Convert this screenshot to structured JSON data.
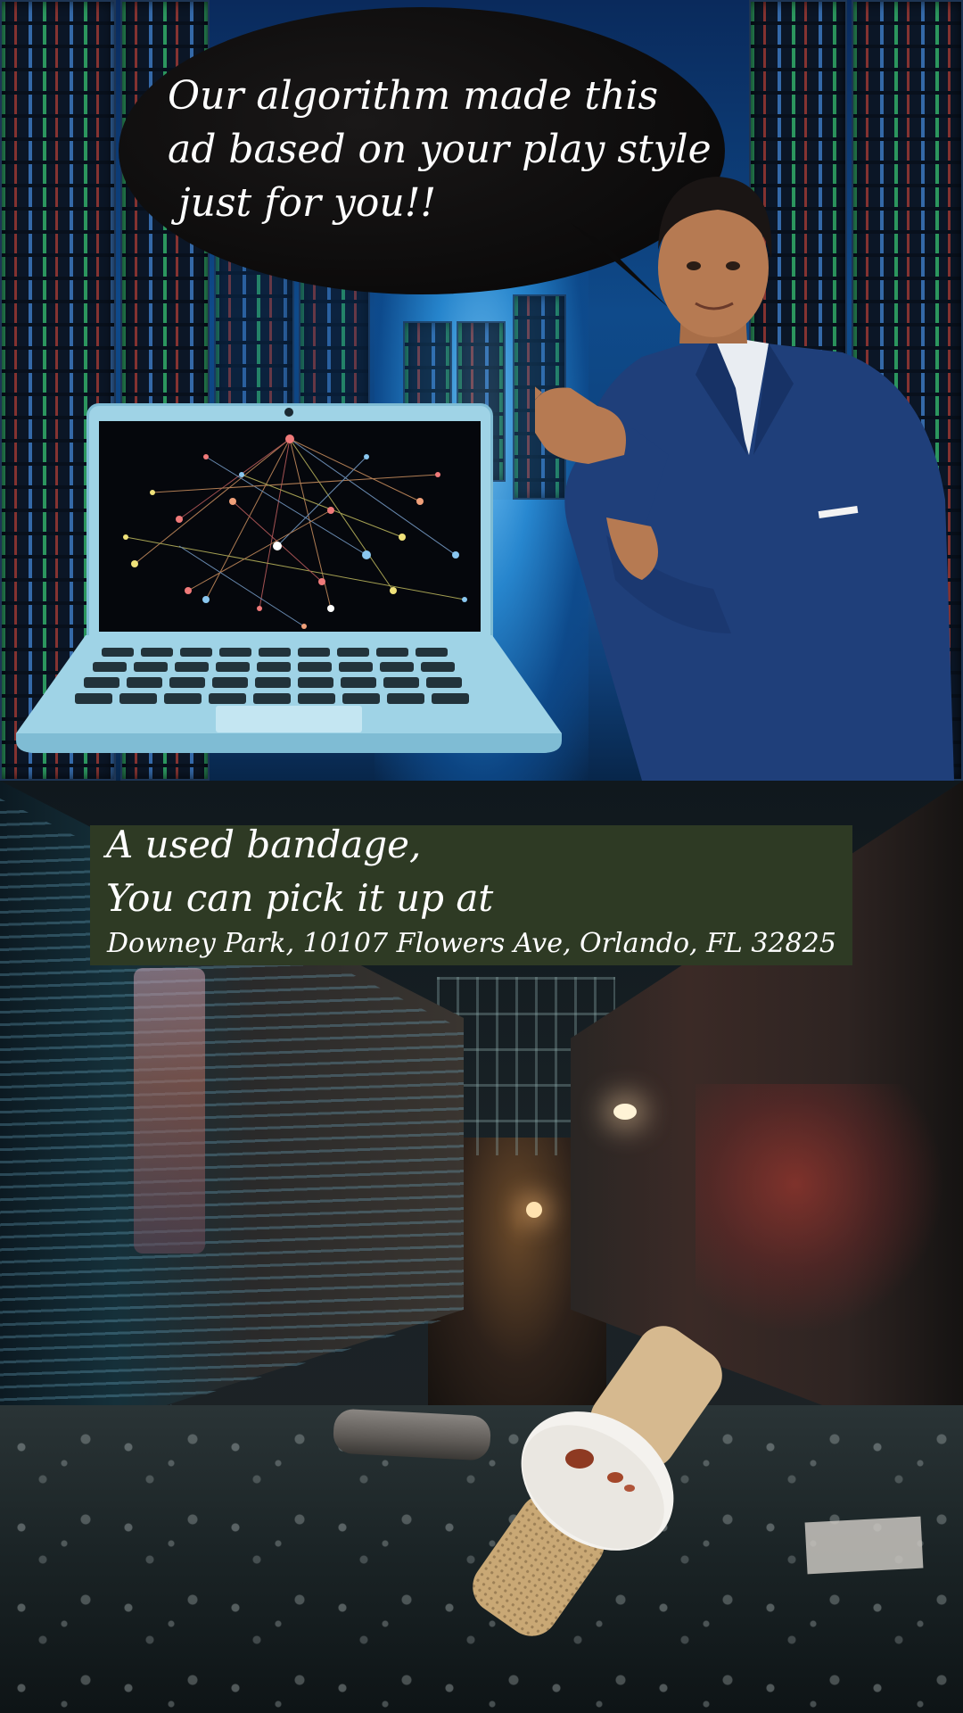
{
  "speech_bubble": {
    "line1": "Our algorithm made this",
    "line2": "ad based on your play style",
    "line3": "just for you!!"
  },
  "caption": {
    "line1": "A used bandage,",
    "line2": "You can pick it up at",
    "line3": "Downey Park, 10107 Flowers Ave, Orlando, FL 32825"
  },
  "colors": {
    "bubble": "#0a0909",
    "caption_box": "#2e3a24",
    "laptop": "#9fd3e6",
    "suit": "#1f3f7a",
    "text": "#ffffff"
  },
  "icons": {
    "laptop": "laptop-icon",
    "bandage": "bandage-icon"
  }
}
